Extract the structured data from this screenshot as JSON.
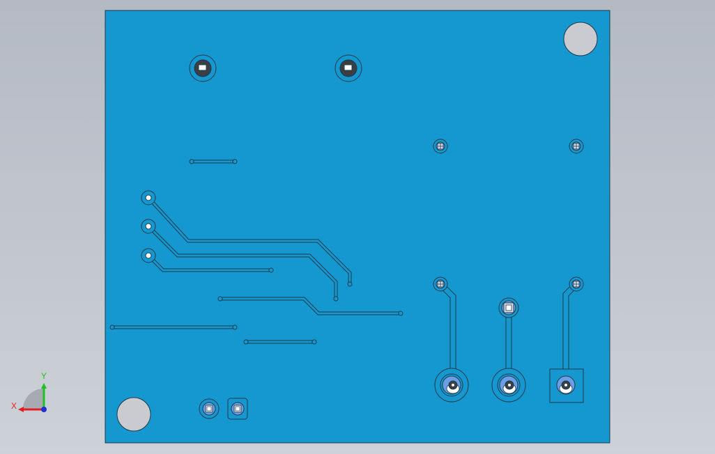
{
  "viewport": {
    "background_top": "#b4bac4",
    "background_bottom": "#cdd1d8"
  },
  "pcb": {
    "board_color": "#1597cf",
    "outline_color": "#1e3a4a",
    "hole_fill": "#c9cbd0",
    "pad_ring": "#6a9fe8",
    "trace_color": "#1e3a4a"
  },
  "triad": {
    "x_label": "X",
    "y_label": "Y",
    "x_color": "#e02020",
    "y_color": "#20c020",
    "z_color": "#2030d0"
  }
}
